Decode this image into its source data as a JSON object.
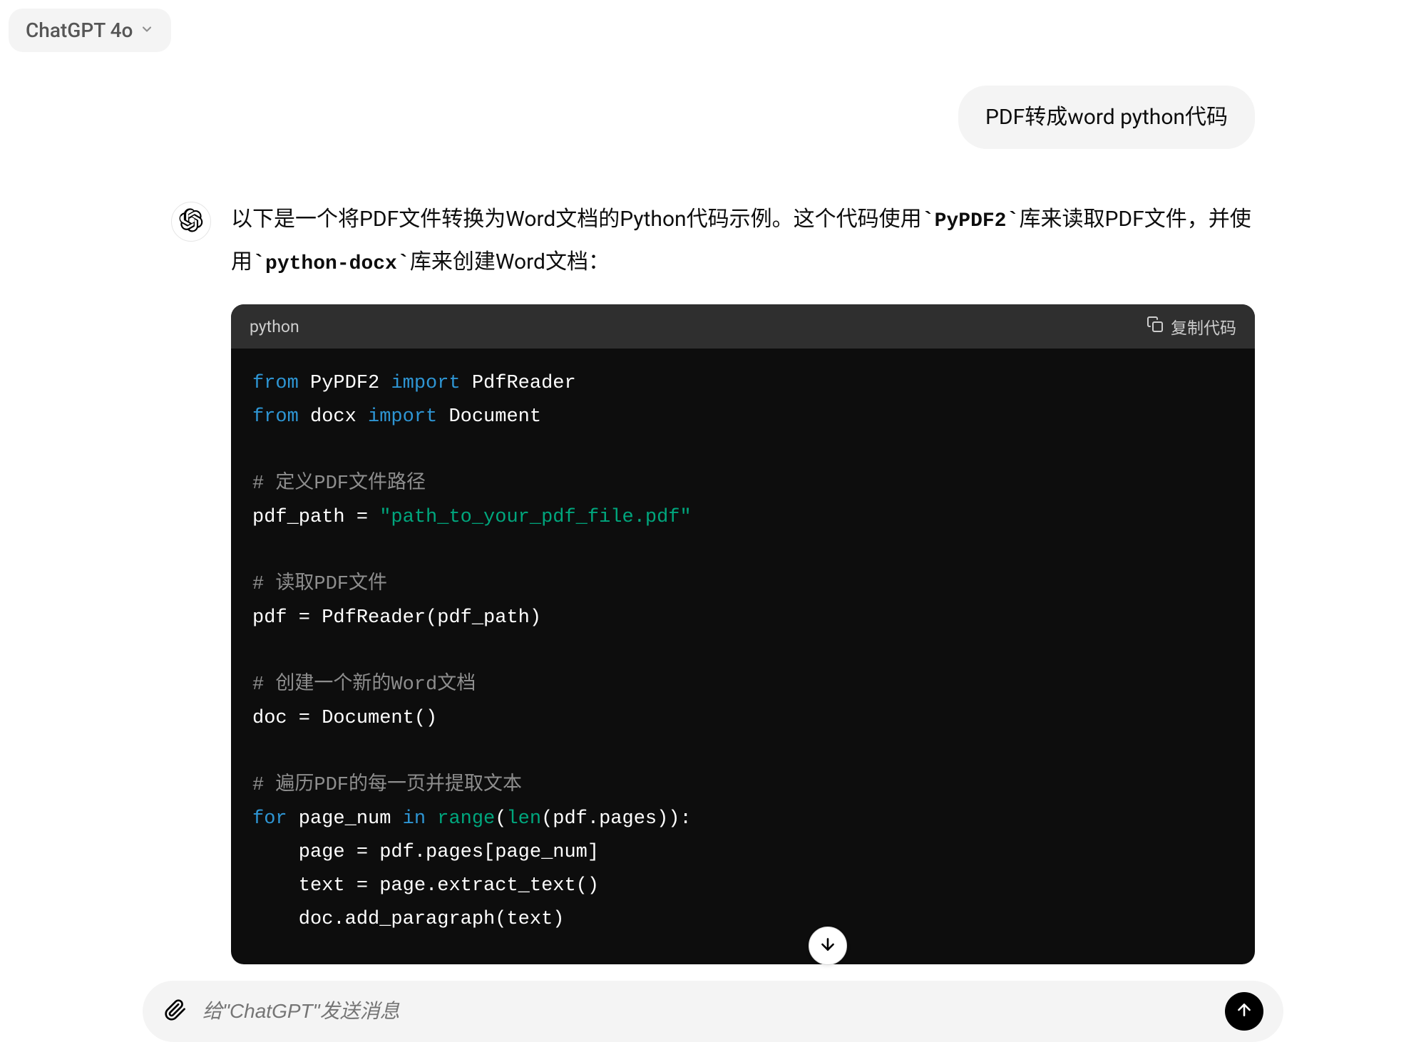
{
  "header": {
    "model": "ChatGPT 4o"
  },
  "user_message": "PDF转成word python代码",
  "assistant": {
    "intro_pre": "以下是一个将PDF文件转换为Word文档的Python代码示例。这个代码使用",
    "lib1": "PyPDF2",
    "intro_mid": "库来读取PDF文件，并使用",
    "lib2": "python-docx",
    "intro_post": "库来创建Word文档："
  },
  "code": {
    "language_label": "python",
    "copy_label": "复制代码",
    "lines": {
      "l1_from": "from",
      "l1_mod": " PyPDF2 ",
      "l1_import": "import",
      "l1_name": " PdfReader",
      "l2_from": "from",
      "l2_mod": " docx ",
      "l2_import": "import",
      "l2_name": " Document",
      "c1": "# 定义PDF文件路径",
      "l3a": "pdf_path = ",
      "l3b": "\"path_to_your_pdf_file.pdf\"",
      "c2": "# 读取PDF文件",
      "l4": "pdf = PdfReader(pdf_path)",
      "c3": "# 创建一个新的Word文档",
      "l5": "doc = Document()",
      "c4": "# 遍历PDF的每一页并提取文本",
      "l6_for": "for",
      "l6_a": " page_num ",
      "l6_in": "in",
      "l6_sp": " ",
      "l6_range": "range",
      "l6_open": "(",
      "l6_len": "len",
      "l6_b": "(pdf.pages)):",
      "l7": "    page = pdf.pages[page_num]",
      "l8": "    text = page.extract_text()",
      "l9": "    doc.add_paragraph(text)"
    }
  },
  "composer": {
    "placeholder": "给\"ChatGPT\"发送消息"
  }
}
